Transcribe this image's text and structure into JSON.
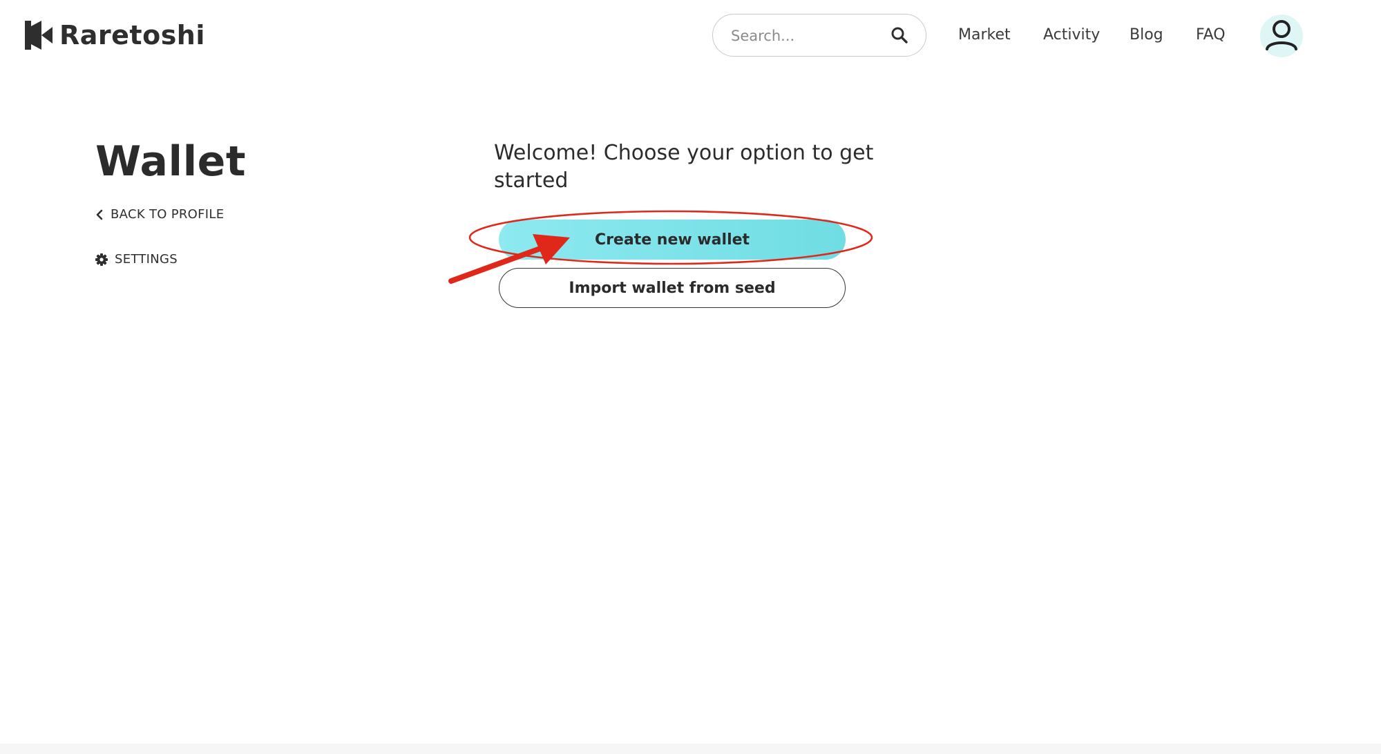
{
  "header": {
    "brand": "Raretoshi",
    "search": {
      "placeholder": "Search...",
      "value": ""
    },
    "nav": [
      {
        "label": "Market"
      },
      {
        "label": "Activity"
      },
      {
        "label": "Blog"
      },
      {
        "label": "FAQ"
      }
    ],
    "avatar_icon": "user-icon"
  },
  "sidebar": {
    "title": "Wallet",
    "back_label": "BACK TO PROFILE",
    "settings_label": "SETTINGS"
  },
  "main": {
    "welcome_text": "Welcome! Choose your option to get started",
    "create_label": "Create new wallet",
    "import_label": "Import wallet from seed"
  },
  "colors": {
    "accent": "#7ce4ea",
    "annotation": "#e0281a",
    "text": "#2b2b2b",
    "avatar_bg": "#dff6f7"
  },
  "icons": {
    "logo": "raretoshi-logo-icon",
    "search": "search-icon",
    "back": "chevron-left-icon",
    "settings": "gear-icon",
    "avatar": "user-icon",
    "annotation": "red-arrow-annotation"
  }
}
